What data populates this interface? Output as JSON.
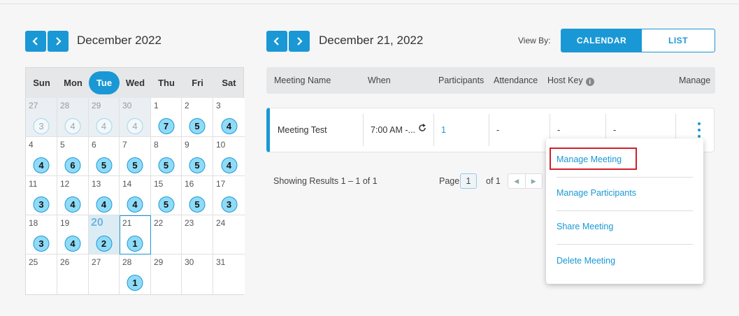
{
  "mini_calendar": {
    "month_label": "December 2022",
    "prev_icon": "chevron-left-icon",
    "next_icon": "chevron-right-icon",
    "weekdays": [
      "Sun",
      "Mon",
      "Tue",
      "Wed",
      "Thu",
      "Fri",
      "Sat"
    ],
    "today_weekday_index": 2,
    "days": [
      {
        "d": "27",
        "n": "3",
        "other": true
      },
      {
        "d": "28",
        "n": "4",
        "other": true
      },
      {
        "d": "29",
        "n": "4",
        "other": true
      },
      {
        "d": "30",
        "n": "4",
        "other": true
      },
      {
        "d": "1",
        "n": "7"
      },
      {
        "d": "2",
        "n": "5"
      },
      {
        "d": "3",
        "n": "4"
      },
      {
        "d": "4",
        "n": "4"
      },
      {
        "d": "5",
        "n": "6"
      },
      {
        "d": "6",
        "n": "5"
      },
      {
        "d": "7",
        "n": "5"
      },
      {
        "d": "8",
        "n": "5"
      },
      {
        "d": "9",
        "n": "5"
      },
      {
        "d": "10",
        "n": "4"
      },
      {
        "d": "11",
        "n": "3"
      },
      {
        "d": "12",
        "n": "4"
      },
      {
        "d": "13",
        "n": "4"
      },
      {
        "d": "14",
        "n": "4"
      },
      {
        "d": "15",
        "n": "5"
      },
      {
        "d": "16",
        "n": "5"
      },
      {
        "d": "17",
        "n": "3"
      },
      {
        "d": "18",
        "n": "3"
      },
      {
        "d": "19",
        "n": "4"
      },
      {
        "d": "20",
        "n": "2",
        "today": true
      },
      {
        "d": "21",
        "n": "1",
        "selected": true
      },
      {
        "d": "22"
      },
      {
        "d": "23"
      },
      {
        "d": "24"
      },
      {
        "d": "25"
      },
      {
        "d": "26"
      },
      {
        "d": "27"
      },
      {
        "d": "28",
        "n": "1"
      },
      {
        "d": "29"
      },
      {
        "d": "30"
      },
      {
        "d": "31"
      }
    ]
  },
  "day_view": {
    "date_label": "December 21, 2022",
    "view_by_label": "View By:",
    "view_calendar": "CALENDAR",
    "view_list": "LIST"
  },
  "table": {
    "headers": {
      "name": "Meeting Name",
      "when": "When",
      "participants": "Participants",
      "attendance": "Attendance",
      "host_key": "Host Key",
      "manage": "Manage"
    },
    "info_icon": "info-icon",
    "row": {
      "name": "Meeting Test",
      "when": "7:00 AM -...",
      "recurring_icon": "recurring-icon",
      "participants": "1",
      "attendance": "-",
      "host_key": "-",
      "extra": "-"
    }
  },
  "pagination": {
    "results": "Showing Results 1 – 1 of 1",
    "page_label": "Page",
    "page_value": "1",
    "of_label": "of 1"
  },
  "manage_menu": {
    "items": [
      "Manage Meeting",
      "Manage Participants",
      "Share Meeting",
      "Delete Meeting"
    ],
    "highlighted_index": 0
  },
  "colors": {
    "accent": "#1a98d5",
    "badge_fill": "#8fdbf7",
    "highlight_border": "#d0202a"
  }
}
